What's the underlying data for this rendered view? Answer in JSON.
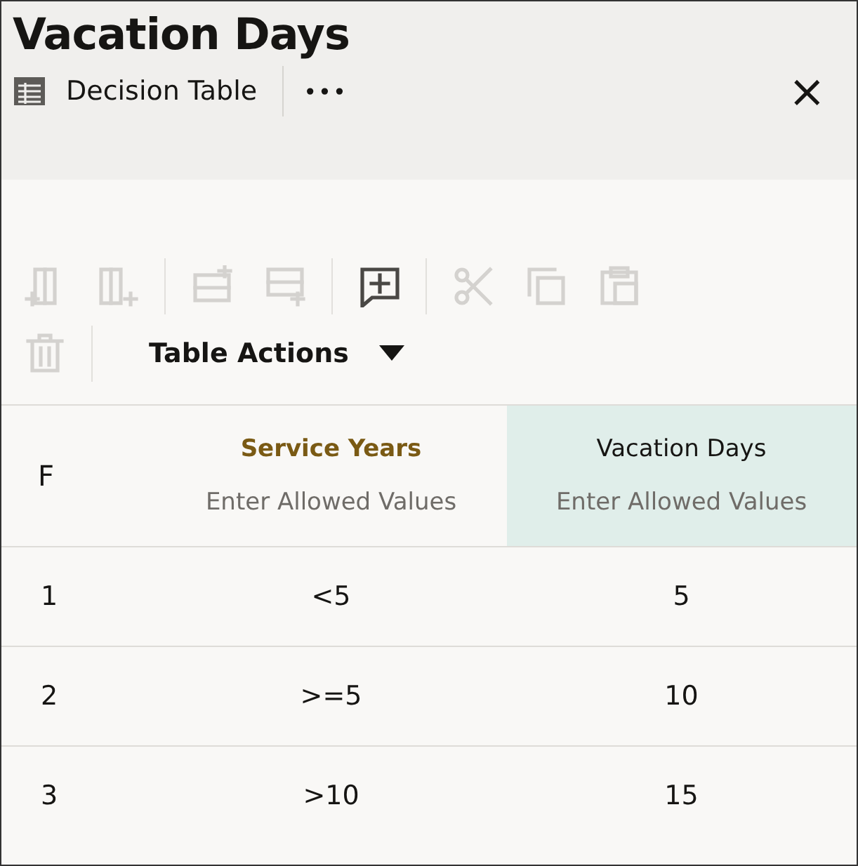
{
  "title": "Vacation Days",
  "subtitle": {
    "label": "Decision Table",
    "more": "•••",
    "close": "×"
  },
  "toolbar": [
    {
      "kind": "col-before",
      "disabled": true
    },
    {
      "kind": "col-after",
      "disabled": true
    },
    {
      "kind": "sep"
    },
    {
      "kind": "row-above",
      "disabled": true
    },
    {
      "kind": "row-below",
      "disabled": true
    },
    {
      "kind": "sep"
    },
    {
      "kind": "comment",
      "disabled": false
    },
    {
      "kind": "sep"
    },
    {
      "kind": "cut",
      "disabled": true
    },
    {
      "kind": "copy",
      "disabled": true
    },
    {
      "kind": "paste",
      "disabled": true
    },
    {
      "kind": "break"
    },
    {
      "kind": "delete",
      "disabled": true
    },
    {
      "kind": "sep"
    },
    {
      "kind": "menu",
      "label": "Table Actions"
    }
  ],
  "table": {
    "first_column": "F",
    "columns": [
      {
        "kind": "condition",
        "name": "Service Years",
        "placeholder": "Enter Allowed Values"
      },
      {
        "kind": "action",
        "name": "Vacation Days",
        "placeholder": "Enter Allowed Values"
      }
    ],
    "rows": [
      {
        "index": "1",
        "cells": [
          "<5",
          "5"
        ]
      },
      {
        "index": "2",
        "cells": [
          ">=5",
          "10"
        ]
      },
      {
        "index": "3",
        "cells": [
          ">10",
          "15"
        ]
      }
    ]
  }
}
